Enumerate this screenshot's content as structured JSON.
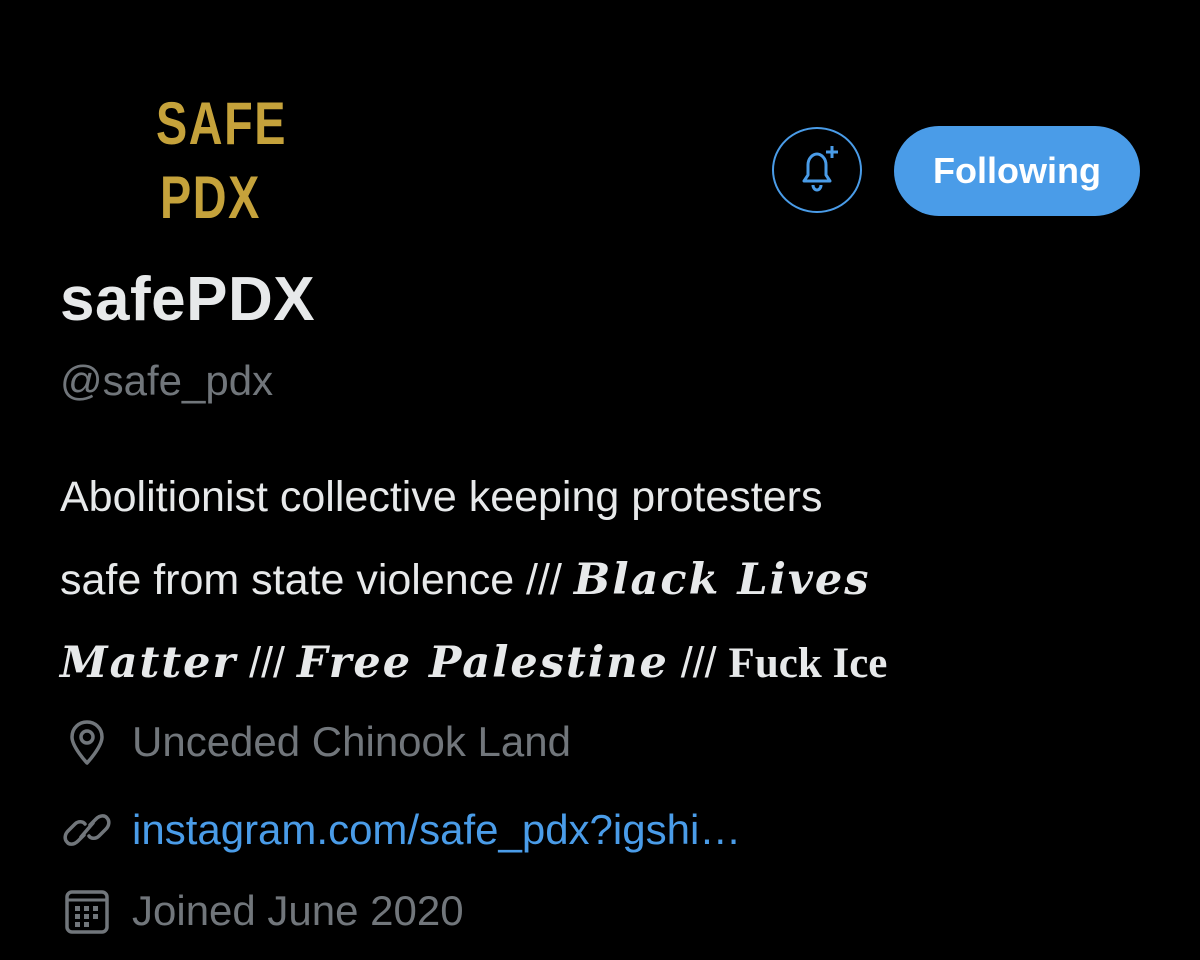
{
  "profile": {
    "avatar_text": [
      "SAFE",
      "PDX"
    ],
    "display_name": "safePDX",
    "handle": "@safe_pdx",
    "bio": {
      "line1": "Abolitionist collective keeping protesters",
      "line2_plain": "safe from state violence /// ",
      "line2_fraktur": "Black Lives",
      "line3_fraktur1": "Matter",
      "line3_sep1": " /// ",
      "line3_fraktur2": "Free Palestine",
      "line3_sep2": " /// ",
      "line3_bold": "Fuck Ice"
    },
    "location": "Unceded Chinook Land",
    "website": "instagram.com/safe_pdx?igshi…",
    "joined": "Joined June 2020"
  },
  "actions": {
    "following_label": "Following"
  },
  "colors": {
    "accent": "#4a9ce8",
    "logo_gold": "#c5a23b",
    "muted": "#71767b",
    "text": "#e7e9ea",
    "background": "#000000"
  }
}
